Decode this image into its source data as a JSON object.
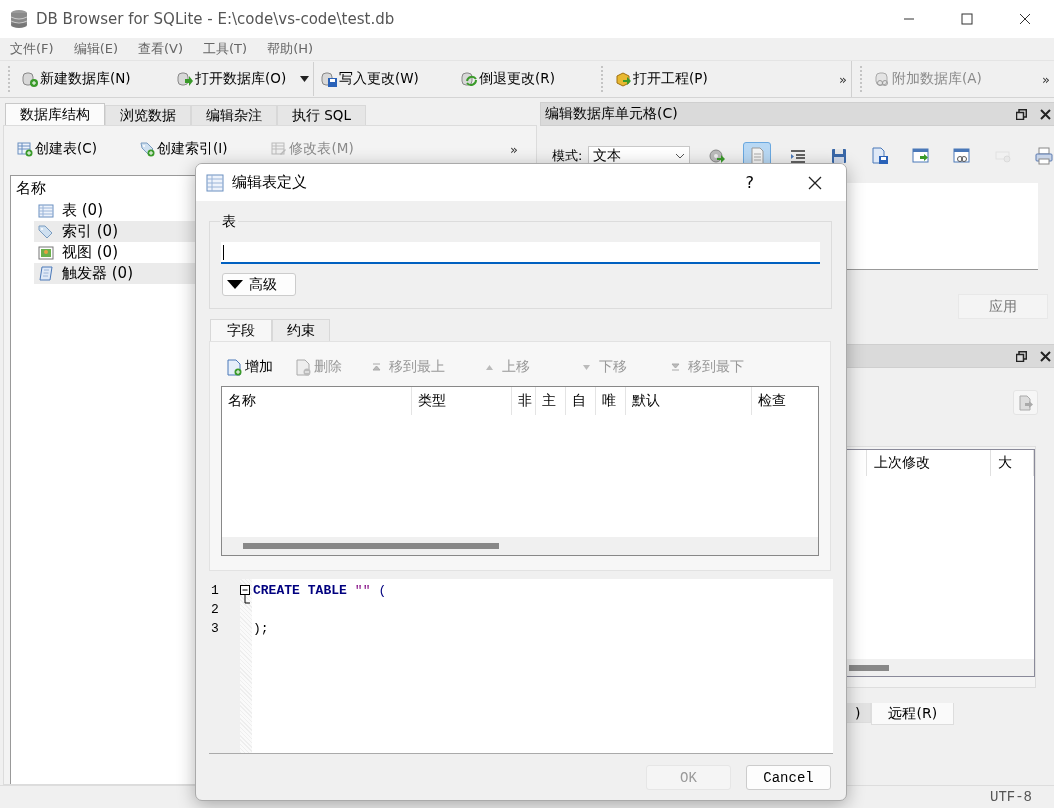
{
  "window": {
    "title": "DB Browser for SQLite - E:\\code\\vs-code\\test.db"
  },
  "menu": [
    "文件(F)",
    "编辑(E)",
    "查看(V)",
    "工具(T)",
    "帮助(H)"
  ],
  "toolbar": [
    {
      "label": "新建数据库(N)",
      "disabled": false
    },
    {
      "label": "打开数据库(O)",
      "disabled": false
    },
    {
      "label": "写入更改(W)",
      "disabled": false
    },
    {
      "label": "倒退更改(R)",
      "disabled": false
    },
    {
      "label": "打开工程(P)",
      "disabled": false
    },
    {
      "label": "附加数据库(A)",
      "disabled": true
    }
  ],
  "toolbar_overflow": [
    "»",
    "»"
  ],
  "tabs": [
    {
      "label": "数据库结构",
      "selected": true
    },
    {
      "label": "浏览数据",
      "selected": false
    },
    {
      "label": "编辑杂注",
      "selected": false
    },
    {
      "label": "执行 SQL",
      "selected": false
    }
  ],
  "structure_toolbar": [
    {
      "label": "创建表(C)",
      "disabled": false
    },
    {
      "label": "创建索引(I)",
      "disabled": false
    },
    {
      "label": "修改表(M)",
      "disabled": true
    }
  ],
  "structure_overflow": "»",
  "tree": {
    "header": "名称",
    "items": [
      {
        "label": "表 (0)"
      },
      {
        "label": "索引 (0)"
      },
      {
        "label": "视图 (0)"
      },
      {
        "label": "触发器 (0)"
      }
    ]
  },
  "cell_editor": {
    "title": "编辑数据库单元格(C)",
    "mode_label": "模式:",
    "mode": "文本",
    "tools": [
      {
        "pressed": false,
        "disabled": false
      },
      {
        "pressed": true,
        "disabled": false
      },
      {
        "pressed": false,
        "disabled": false
      },
      {
        "pressed": false,
        "disabled": false
      },
      {
        "pressed": false,
        "disabled": false
      },
      {
        "pressed": false,
        "disabled": false
      },
      {
        "pressed": false,
        "disabled": false
      },
      {
        "pressed": false,
        "disabled": true
      },
      {
        "pressed": false,
        "disabled": false
      }
    ],
    "apply": {
      "label": "应用",
      "disabled": true
    }
  },
  "remote_dock": {
    "columns": [
      "上次修改",
      "大"
    ],
    "tabs": [
      {
        "label": ")",
        "selected": false
      },
      {
        "label": "远程(R)",
        "selected": true
      }
    ]
  },
  "status_bar": {
    "encoding": "UTF-8"
  },
  "dialog": {
    "title": "编辑表定义",
    "help": "?",
    "group_label": "表",
    "advanced": "高级",
    "tabs": [
      {
        "label": "字段",
        "selected": true
      },
      {
        "label": "约束",
        "selected": false
      }
    ],
    "field_tools": [
      {
        "label": "增加",
        "disabled": false
      },
      {
        "label": "删除",
        "disabled": true
      },
      {
        "label": "移到最上",
        "disabled": true
      },
      {
        "label": "上移",
        "disabled": true
      },
      {
        "label": "下移",
        "disabled": true
      },
      {
        "label": "移到最下",
        "disabled": true
      }
    ],
    "columns": [
      "名称",
      "类型",
      "非",
      "主",
      "自",
      "唯",
      "默认",
      "检查"
    ],
    "sql": [
      {
        "number": "1",
        "tokens": [
          {
            "text": "CREATE",
            "kind": "keyword"
          },
          {
            "text": "TABLE",
            "kind": "keyword"
          },
          {
            "text": "\"\"",
            "kind": "string"
          },
          {
            "text": "(",
            "kind": "operator"
          }
        ]
      },
      {
        "number": "2"
      },
      {
        "number": "3",
        "tokens": [
          {
            "text": ");",
            "kind": "plain"
          }
        ]
      }
    ],
    "buttons": [
      {
        "label": "OK",
        "disabled": true
      },
      {
        "label": "Cancel",
        "disabled": false
      }
    ]
  }
}
